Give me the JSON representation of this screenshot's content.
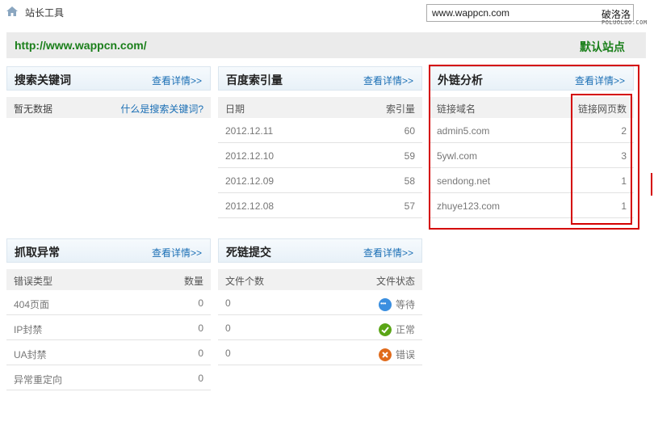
{
  "header": {
    "title": "站长工具",
    "site_input_value": "www.wappcn.com",
    "watermark_cn": "破洛洛",
    "watermark_en": "POLUOLUO.COM"
  },
  "url_bar": {
    "url": "http://www.wappcn.com/",
    "default_label": "默认站点"
  },
  "common": {
    "more": "查看详情>>"
  },
  "keywords": {
    "title": "搜索关键词",
    "empty": "暂无数据",
    "help_link": "什么是搜索关键词?"
  },
  "index": {
    "title": "百度索引量",
    "col_left": "日期",
    "col_right": "索引量",
    "rows": [
      {
        "date": "2012.12.11",
        "value": "60"
      },
      {
        "date": "2012.12.10",
        "value": "59"
      },
      {
        "date": "2012.12.09",
        "value": "58"
      },
      {
        "date": "2012.12.08",
        "value": "57"
      }
    ]
  },
  "links": {
    "title": "外链分析",
    "col_left": "链接域名",
    "col_right": "链接网页数",
    "rows": [
      {
        "domain": "admin5.com",
        "count": "2"
      },
      {
        "domain": "5ywl.com",
        "count": "3"
      },
      {
        "domain": "sendong.net",
        "count": "1"
      },
      {
        "domain": "zhuye123.com",
        "count": "1"
      }
    ]
  },
  "crawl": {
    "title": "抓取异常",
    "col_left": "错误类型",
    "col_right": "数量",
    "rows": [
      {
        "type": "404页面",
        "count": "0"
      },
      {
        "type": "IP封禁",
        "count": "0"
      },
      {
        "type": "UA封禁",
        "count": "0"
      },
      {
        "type": "异常重定向",
        "count": "0"
      }
    ]
  },
  "deadlinks": {
    "title": "死链提交",
    "col_left": "文件个数",
    "col_right": "文件状态",
    "rows": [
      {
        "files": "0",
        "status": "等待",
        "icon": "waiting-icon"
      },
      {
        "files": "0",
        "status": "正常",
        "icon": "check-icon"
      },
      {
        "files": "0",
        "status": "错误",
        "icon": "error-icon"
      }
    ]
  },
  "colors": {
    "accent_link": "#1b6fb5",
    "site_green": "#1a7f1a",
    "highlight_red": "#d40000"
  }
}
